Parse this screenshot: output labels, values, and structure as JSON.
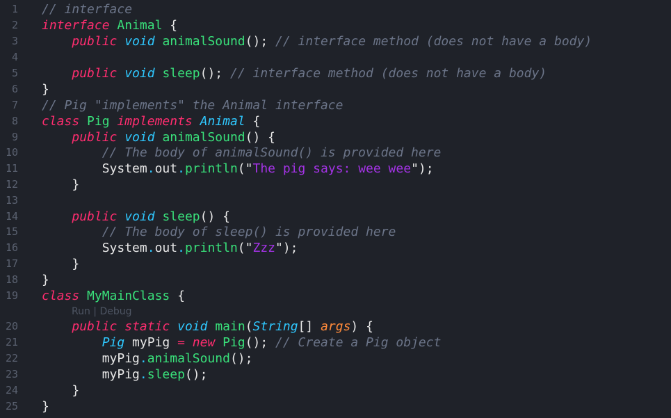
{
  "editor": {
    "lines": [
      {
        "n": "1",
        "t": [
          [
            "cm",
            "// interface"
          ]
        ]
      },
      {
        "n": "2",
        "t": [
          [
            "kw",
            "interface"
          ],
          [
            "plain",
            " "
          ],
          [
            "cls",
            "Animal"
          ],
          [
            "punc",
            " {"
          ]
        ]
      },
      {
        "n": "3",
        "t": [
          [
            "plain",
            "    "
          ],
          [
            "kw",
            "public"
          ],
          [
            "plain",
            " "
          ],
          [
            "ty",
            "void"
          ],
          [
            "plain",
            " "
          ],
          [
            "fn",
            "animalSound"
          ],
          [
            "punc",
            "(); "
          ],
          [
            "cm",
            "// interface method (does not have a body)"
          ]
        ]
      },
      {
        "n": "4",
        "t": []
      },
      {
        "n": "5",
        "t": [
          [
            "plain",
            "    "
          ],
          [
            "kw",
            "public"
          ],
          [
            "plain",
            " "
          ],
          [
            "ty",
            "void"
          ],
          [
            "plain",
            " "
          ],
          [
            "fn",
            "sleep"
          ],
          [
            "punc",
            "(); "
          ],
          [
            "cm",
            "// interface method (does not have a body)"
          ]
        ]
      },
      {
        "n": "6",
        "t": [
          [
            "punc",
            "}"
          ]
        ]
      },
      {
        "n": "7",
        "t": [
          [
            "cm",
            "// Pig \"implements\" the Animal interface"
          ]
        ]
      },
      {
        "n": "8",
        "t": [
          [
            "kw",
            "class"
          ],
          [
            "plain",
            " "
          ],
          [
            "cls",
            "Pig"
          ],
          [
            "plain",
            " "
          ],
          [
            "kw",
            "implements"
          ],
          [
            "plain",
            " "
          ],
          [
            "ty",
            "Animal"
          ],
          [
            "punc",
            " {"
          ]
        ]
      },
      {
        "n": "9",
        "t": [
          [
            "plain",
            "    "
          ],
          [
            "kw",
            "public"
          ],
          [
            "plain",
            " "
          ],
          [
            "ty",
            "void"
          ],
          [
            "plain",
            " "
          ],
          [
            "fn",
            "animalSound"
          ],
          [
            "punc",
            "() {"
          ]
        ]
      },
      {
        "n": "10",
        "t": [
          [
            "plain",
            "        "
          ],
          [
            "cm",
            "// The body of animalSound() is provided here"
          ]
        ]
      },
      {
        "n": "11",
        "t": [
          [
            "plain",
            "        "
          ],
          [
            "plain",
            "System"
          ],
          [
            "dot",
            "."
          ],
          [
            "plain",
            "out"
          ],
          [
            "dot",
            "."
          ],
          [
            "fn",
            "println"
          ],
          [
            "punc",
            "(\""
          ],
          [
            "str",
            "The pig says: wee wee"
          ],
          [
            "punc",
            "\");"
          ]
        ]
      },
      {
        "n": "12",
        "t": [
          [
            "plain",
            "    "
          ],
          [
            "punc",
            "}"
          ]
        ]
      },
      {
        "n": "13",
        "t": []
      },
      {
        "n": "14",
        "t": [
          [
            "plain",
            "    "
          ],
          [
            "kw",
            "public"
          ],
          [
            "plain",
            " "
          ],
          [
            "ty",
            "void"
          ],
          [
            "plain",
            " "
          ],
          [
            "fn",
            "sleep"
          ],
          [
            "punc",
            "() {"
          ]
        ]
      },
      {
        "n": "15",
        "t": [
          [
            "plain",
            "        "
          ],
          [
            "cm",
            "// The body of sleep() is provided here"
          ]
        ]
      },
      {
        "n": "16",
        "t": [
          [
            "plain",
            "        "
          ],
          [
            "plain",
            "System"
          ],
          [
            "dot",
            "."
          ],
          [
            "plain",
            "out"
          ],
          [
            "dot",
            "."
          ],
          [
            "fn",
            "println"
          ],
          [
            "punc",
            "(\""
          ],
          [
            "str",
            "Zzz"
          ],
          [
            "punc",
            "\");"
          ]
        ]
      },
      {
        "n": "17",
        "t": [
          [
            "plain",
            "    "
          ],
          [
            "punc",
            "}"
          ]
        ]
      },
      {
        "n": "18",
        "t": [
          [
            "punc",
            "}"
          ]
        ]
      },
      {
        "n": "19",
        "t": [
          [
            "kw",
            "class"
          ],
          [
            "plain",
            " "
          ],
          [
            "cls",
            "MyMainClass"
          ],
          [
            "punc",
            " {"
          ]
        ]
      },
      {
        "n": "20",
        "t": [
          [
            "plain",
            "    "
          ],
          [
            "kw",
            "public"
          ],
          [
            "plain",
            " "
          ],
          [
            "kw",
            "static"
          ],
          [
            "plain",
            " "
          ],
          [
            "ty",
            "void"
          ],
          [
            "plain",
            " "
          ],
          [
            "fn",
            "main"
          ],
          [
            "punc",
            "("
          ],
          [
            "ty",
            "String"
          ],
          [
            "punc",
            "[] "
          ],
          [
            "param",
            "args"
          ],
          [
            "punc",
            ") {"
          ]
        ]
      },
      {
        "n": "21",
        "t": [
          [
            "plain",
            "        "
          ],
          [
            "ty",
            "Pig"
          ],
          [
            "plain",
            " myPig "
          ],
          [
            "kw",
            "="
          ],
          [
            "plain",
            " "
          ],
          [
            "kw",
            "new"
          ],
          [
            "plain",
            " "
          ],
          [
            "fn",
            "Pig"
          ],
          [
            "punc",
            "(); "
          ],
          [
            "cm",
            "// Create a Pig object"
          ]
        ]
      },
      {
        "n": "22",
        "t": [
          [
            "plain",
            "        "
          ],
          [
            "plain",
            "myPig"
          ],
          [
            "dot",
            "."
          ],
          [
            "fn",
            "animalSound"
          ],
          [
            "punc",
            "();"
          ]
        ]
      },
      {
        "n": "23",
        "t": [
          [
            "plain",
            "        "
          ],
          [
            "plain",
            "myPig"
          ],
          [
            "dot",
            "."
          ],
          [
            "fn",
            "sleep"
          ],
          [
            "punc",
            "();"
          ]
        ]
      },
      {
        "n": "24",
        "t": [
          [
            "plain",
            "    "
          ],
          [
            "punc",
            "}"
          ]
        ]
      },
      {
        "n": "25",
        "t": [
          [
            "punc",
            "}"
          ]
        ]
      }
    ],
    "codelens": "Run | Debug"
  },
  "colors": {
    "background": "#1f2229",
    "keyword": "#ff2d6f",
    "type": "#2fc8ff",
    "identifier": "#39e07a",
    "comment": "#6b7488",
    "string": "#a433e6",
    "parameter": "#ff8a3a"
  }
}
